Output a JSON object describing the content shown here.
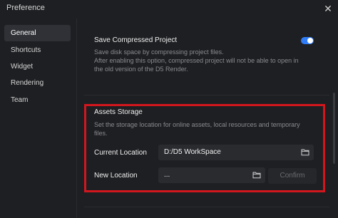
{
  "window": {
    "title": "Preference",
    "close_glyph": "✕"
  },
  "sidebar": {
    "items": [
      {
        "label": "General",
        "active": true
      },
      {
        "label": "Shortcuts",
        "active": false
      },
      {
        "label": "Widget",
        "active": false
      },
      {
        "label": "Rendering",
        "active": false
      },
      {
        "label": "Team",
        "active": false
      }
    ]
  },
  "compress": {
    "title": "Save Compressed Project",
    "desc_line1": "Save disk space by compressing project files.",
    "desc_line2": "After enabling this option, compressed project will not be able to open in",
    "desc_line3": "the old version of the D5 Render.",
    "enabled": true
  },
  "assets": {
    "title": "Assets Storage",
    "desc_line1": "Set the storage location for online assets, local resources and temporary",
    "desc_line2": "files.",
    "current_label": "Current Location",
    "current_value": "D:/D5 WorkSpace",
    "new_label": "New Location",
    "new_value": "...",
    "confirm_label": "Confirm"
  },
  "colors": {
    "accent": "#2f7cf6",
    "highlight": "#d2161e",
    "background": "#1e1f22"
  }
}
